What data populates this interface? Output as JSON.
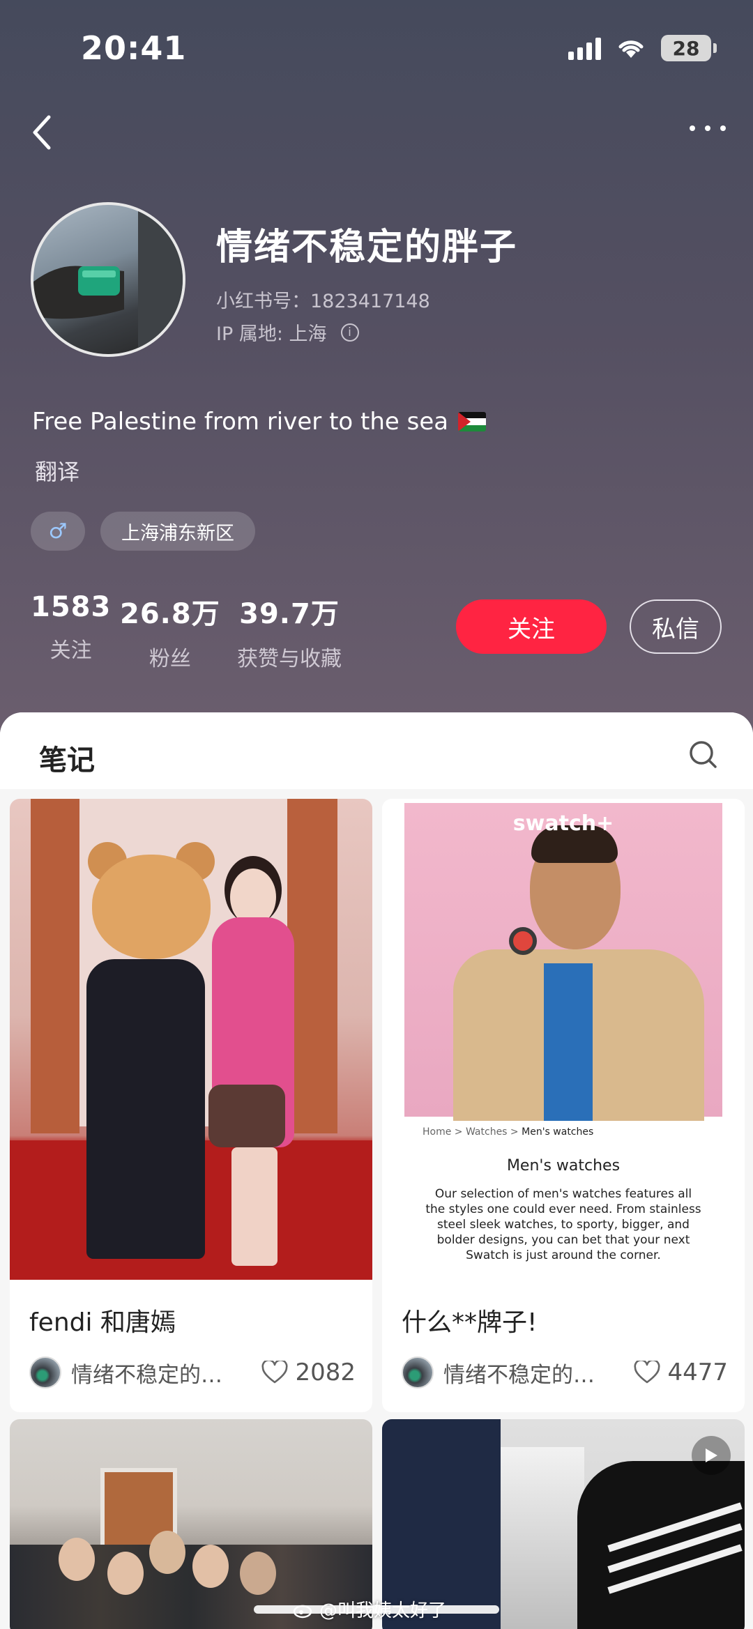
{
  "status_bar": {
    "time": "20:41",
    "battery": "28"
  },
  "profile": {
    "name": "情绪不稳定的胖子",
    "red_id": "小红书号：1823417148",
    "ip_location": "IP 属地: 上海",
    "bio": "Free Palestine from river to the sea",
    "translate_label": "翻译",
    "tags": {
      "gender": "♂",
      "location": "上海浦东新区"
    },
    "stats": [
      {
        "value": "1583",
        "label": "关注"
      },
      {
        "value": "26.8万",
        "label": "粉丝"
      },
      {
        "value": "39.7万",
        "label": "获赞与收藏"
      }
    ],
    "follow_label": "关注",
    "message_label": "私信"
  },
  "tabs": {
    "notes_label": "笔记"
  },
  "cards": [
    {
      "title": "fendi 和唐嫣",
      "author": "情绪不稳定的…",
      "likes": "2082"
    },
    {
      "title": "什么**牌子!",
      "author": "情绪不稳定的…",
      "likes": "4477",
      "image_text": {
        "brand": "swatch+",
        "crumb_home": "Home",
        "crumb_watches": "Watches",
        "crumb_current": "Men's watches",
        "heading": "Men's watches",
        "description": "Our selection of men's watches features all the styles one could ever need. From stainless steel sleek watches, to sporty, bigger, and bolder designs, you can bet that your next Swatch is just around the corner."
      }
    }
  ],
  "watermark": "@叫我姨太好了",
  "colors": {
    "accent": "#ff2442",
    "header_top": "#454a5c",
    "header_bottom": "#6b5e6e"
  }
}
